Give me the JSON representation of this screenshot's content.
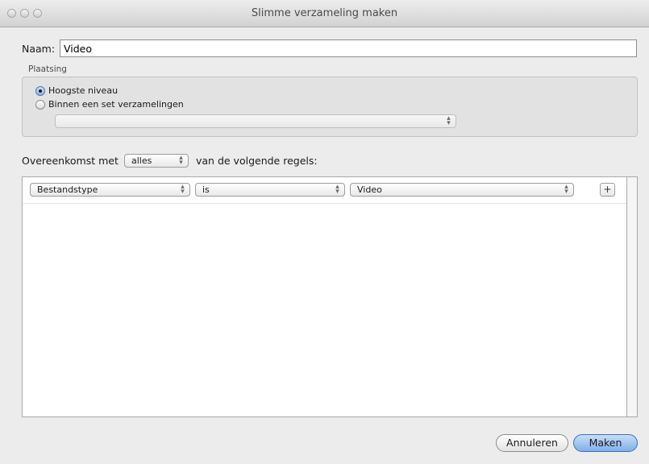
{
  "window": {
    "title": "Slimme verzameling maken"
  },
  "name_field": {
    "label": "Naam:",
    "value": "Video"
  },
  "placement": {
    "label": "Plaatsing",
    "options": [
      {
        "label": "Hoogste niveau",
        "selected": true
      },
      {
        "label": "Binnen een set verzamelingen",
        "selected": false
      }
    ],
    "collection_popup_value": ""
  },
  "match": {
    "prefix": "Overeenkomst met",
    "value": "alles",
    "suffix": "van de volgende regels:"
  },
  "rules": [
    {
      "field": "Bestandstype",
      "operator": "is",
      "value": "Video"
    }
  ],
  "add_rule_label": "+",
  "buttons": {
    "cancel": "Annuleren",
    "ok": "Maken"
  },
  "colors": {
    "accent": "#7fb0ea",
    "window_bg": "#ececec"
  }
}
